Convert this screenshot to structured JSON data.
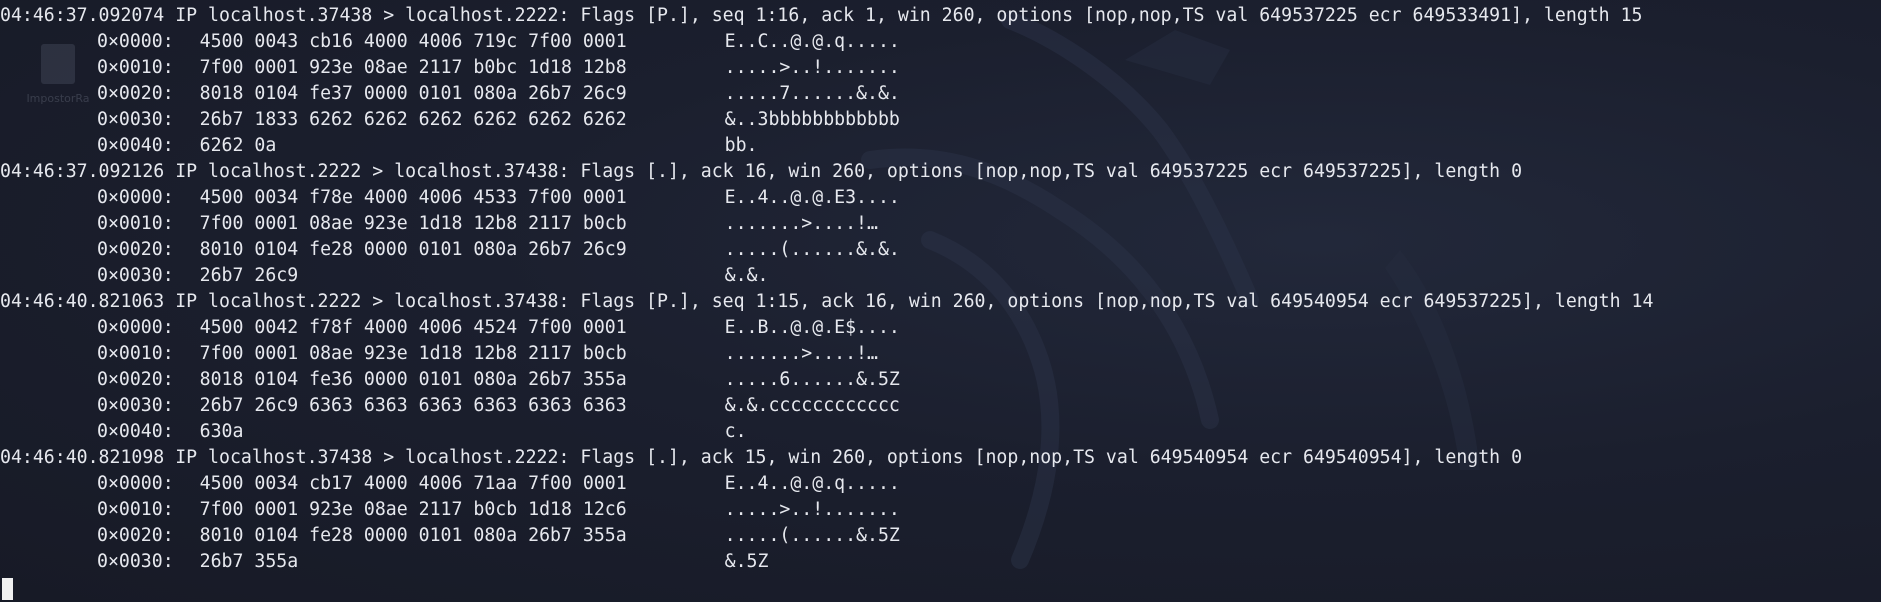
{
  "desktop": {
    "icon_label": "ImpostorRa"
  },
  "terminal": {
    "blocks": [
      {
        "header": "04:46:37.092074 IP localhost.37438 > localhost.2222: Flags [P.], seq 1:16, ack 1, win 260, options [nop,nop,TS val 649537225 ecr 649533491], length 15",
        "rows": [
          {
            "offset": "0×0000:",
            "hex": "4500 0043 cb16 4000 4006 719c 7f00 0001",
            "ascii": "E..C..@.@.q....."
          },
          {
            "offset": "0×0010:",
            "hex": "7f00 0001 923e 08ae 2117 b0bc 1d18 12b8",
            "ascii": ".....>..!......."
          },
          {
            "offset": "0×0020:",
            "hex": "8018 0104 fe37 0000 0101 080a 26b7 26c9",
            "ascii": ".....7......&.&."
          },
          {
            "offset": "0×0030:",
            "hex": "26b7 1833 6262 6262 6262 6262 6262 6262",
            "ascii": "&..3bbbbbbbbbbbb"
          },
          {
            "offset": "0×0040:",
            "hex": "6262 0a",
            "ascii": "bb."
          }
        ]
      },
      {
        "header": "04:46:37.092126 IP localhost.2222 > localhost.37438: Flags [.], ack 16, win 260, options [nop,nop,TS val 649537225 ecr 649537225], length 0",
        "rows": [
          {
            "offset": "0×0000:",
            "hex": "4500 0034 f78e 4000 4006 4533 7f00 0001",
            "ascii": "E..4..@.@.E3...."
          },
          {
            "offset": "0×0010:",
            "hex": "7f00 0001 08ae 923e 1d18 12b8 2117 b0cb",
            "ascii": ".......>....!…"
          },
          {
            "offset": "0×0020:",
            "hex": "8010 0104 fe28 0000 0101 080a 26b7 26c9",
            "ascii": ".....(......&.&."
          },
          {
            "offset": "0×0030:",
            "hex": "26b7 26c9",
            "ascii": "&.&."
          }
        ]
      },
      {
        "header": "04:46:40.821063 IP localhost.2222 > localhost.37438: Flags [P.], seq 1:15, ack 16, win 260, options [nop,nop,TS val 649540954 ecr 649537225], length 14",
        "rows": [
          {
            "offset": "0×0000:",
            "hex": "4500 0042 f78f 4000 4006 4524 7f00 0001",
            "ascii": "E..B..@.@.E$...."
          },
          {
            "offset": "0×0010:",
            "hex": "7f00 0001 08ae 923e 1d18 12b8 2117 b0cb",
            "ascii": ".......>....!…"
          },
          {
            "offset": "0×0020:",
            "hex": "8018 0104 fe36 0000 0101 080a 26b7 355a",
            "ascii": ".....6......&.5Z"
          },
          {
            "offset": "0×0030:",
            "hex": "26b7 26c9 6363 6363 6363 6363 6363 6363",
            "ascii": "&.&.cccccccccccc"
          },
          {
            "offset": "0×0040:",
            "hex": "630a",
            "ascii": "c."
          }
        ]
      },
      {
        "header": "04:46:40.821098 IP localhost.37438 > localhost.2222: Flags [.], ack 15, win 260, options [nop,nop,TS val 649540954 ecr 649540954], length 0",
        "rows": [
          {
            "offset": "0×0000:",
            "hex": "4500 0034 cb17 4000 4006 71aa 7f00 0001",
            "ascii": "E..4..@.@.q....."
          },
          {
            "offset": "0×0010:",
            "hex": "7f00 0001 923e 08ae 2117 b0cb 1d18 12c6",
            "ascii": ".....>..!......."
          },
          {
            "offset": "0×0020:",
            "hex": "8010 0104 fe28 0000 0101 080a 26b7 355a",
            "ascii": ".....(......&.5Z"
          },
          {
            "offset": "0×0030:",
            "hex": "26b7 355a",
            "ascii": "&.5Z"
          }
        ]
      }
    ]
  },
  "colors": {
    "background": "#1b1f2e",
    "text": "#e6e8ee",
    "cursor": "#f0f0f0"
  }
}
